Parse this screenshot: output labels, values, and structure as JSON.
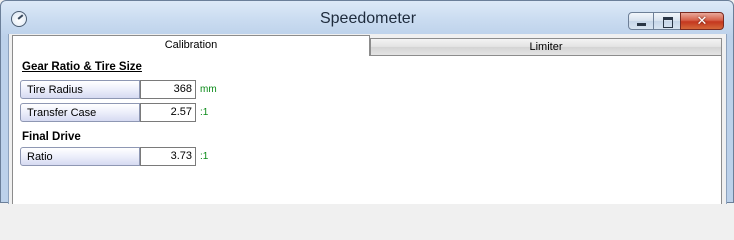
{
  "window": {
    "title": "Speedometer"
  },
  "tabs": [
    {
      "label": "Calibration",
      "active": true
    },
    {
      "label": "Limiter",
      "active": false
    }
  ],
  "sections": {
    "gear": {
      "title": "Gear Ratio & Tire Size",
      "rows": [
        {
          "label": "Tire Radius",
          "value": "368",
          "unit": "mm"
        },
        {
          "label": "Transfer Case",
          "value": "2.57",
          "unit": ":1"
        }
      ]
    },
    "final": {
      "title": "Final Drive",
      "rows": [
        {
          "label": "Ratio",
          "value": "3.73",
          "unit": ":1"
        }
      ]
    }
  },
  "colors": {
    "unit_text": "#0a8a18",
    "close_button": "#c4371f"
  },
  "icons": {
    "app": "speedometer-icon",
    "minimize": "minimize-icon",
    "maximize": "maximize-icon",
    "close": "close-icon"
  }
}
